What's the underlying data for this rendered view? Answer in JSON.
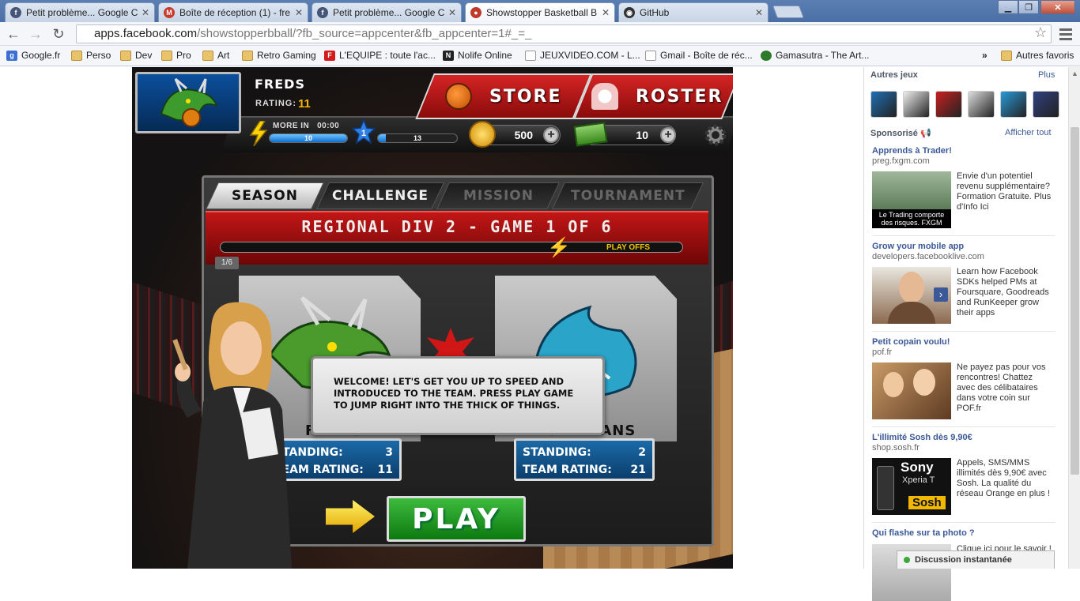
{
  "browser": {
    "tabs": [
      {
        "title": "Petit problème... Google C",
        "favicon_color": "#445577",
        "active": false
      },
      {
        "title": "Boîte de réception (1) - fre",
        "favicon_color": "#c73b2c",
        "active": false
      },
      {
        "title": "Petit problème... Google C",
        "favicon_color": "#445577",
        "active": false
      },
      {
        "title": "Showstopper Basketball B",
        "favicon_color": "#c0392b",
        "active": true
      },
      {
        "title": "GitHub",
        "favicon_color": "#333333",
        "active": false
      }
    ],
    "url_host": "apps.facebook.com",
    "url_path": "/showstopperbball/?fb_source=appcenter&fb_appcenter=1#_=_",
    "bookmarks": [
      {
        "label": "Google.fr",
        "icon": "google-icon"
      },
      {
        "label": "Perso",
        "icon": "folder-icon"
      },
      {
        "label": "Dev",
        "icon": "folder-icon"
      },
      {
        "label": "Pro",
        "icon": "folder-icon"
      },
      {
        "label": "Art",
        "icon": "folder-icon"
      },
      {
        "label": "Retro Gaming",
        "icon": "folder-icon"
      },
      {
        "label": "L'EQUIPE : toute l'ac...",
        "icon": "lequipe-icon"
      },
      {
        "label": "Nolife Online",
        "icon": "nolife-icon"
      },
      {
        "label": "JEUXVIDEO.COM - L...",
        "icon": "page-icon"
      },
      {
        "label": "Gmail - Boîte de réc...",
        "icon": "page-icon"
      },
      {
        "label": "Gamasutra - The Art...",
        "icon": "gamasutra-icon"
      }
    ],
    "bookmarks_overflow": "»",
    "other_bookmarks": "Autres favoris"
  },
  "game": {
    "team_name": "FREDS",
    "rating_label": "RATING:",
    "rating_value": "11",
    "store_label": "STORE",
    "roster_label": "ROSTER",
    "more_in_label": "MORE IN",
    "more_in_time": "00:00",
    "energy_value": "10",
    "energy_fraction": 1.0,
    "level": "1",
    "xp_value": "13",
    "xp_fraction": 0.1,
    "coins": "500",
    "cash": "10",
    "tabs": [
      "SEASON",
      "CHALLENGE",
      "MISSION",
      "TOURNAMENT"
    ],
    "game_title": "REGIONAL DIV 2 - GAME 1 OF 6",
    "playoffs_label": "PLAY OFFS",
    "step_badge": "1/6",
    "progress_fraction": 0.0,
    "home_team": {
      "name": "FREDS",
      "standing_label": "STANDING:",
      "standing": "3",
      "rating_label": "TEAM RATING:",
      "rating": "11"
    },
    "away_team": {
      "name": "SPARTANS",
      "standing_label": "STANDING:",
      "standing": "2",
      "rating_label": "TEAM RATING:",
      "rating": "21"
    },
    "welcome_text": "WELCOME! LET'S GET YOU UP TO SPEED AND INTRODUCED TO THE TEAM. PRESS PLAY GAME TO JUMP RIGHT INTO THE THICK OF THINGS.",
    "play_label": "PLAY"
  },
  "sidebar": {
    "other_games_label": "Autres jeux",
    "more_label": "Plus",
    "game_icons": [
      "#1e6fb5",
      "#eeeeee",
      "#c82020",
      "#dddddd",
      "#2a9ad8",
      "#304080"
    ],
    "sponsored_label": "Sponsorisé",
    "show_all_label": "Afficher tout",
    "ads": [
      {
        "title": "Apprends à Trader!",
        "domain": "preg.fxgm.com",
        "body": "Envie d'un potentiel revenu supplémentaire? Formation Gratuite. Plus d'Info Ici",
        "image_caption": "Le Trading comporte des risques. FXGM"
      },
      {
        "title": "Grow your mobile app",
        "domain": "developers.facebooklive.com",
        "body": "Learn how Facebook SDKs helped PMs at Foursquare, Goodreads and RunKeeper grow their apps",
        "image_caption": ""
      },
      {
        "title": "Petit copain voulu!",
        "domain": "pof.fr",
        "body": "Ne payez pas pour vos rencontres! Chattez avec des célibataires dans votre coin sur POF.fr",
        "image_caption": ""
      },
      {
        "title": "L'illimité Sosh dès 9,90€",
        "domain": "shop.sosh.fr",
        "body": "Appels, SMS/MMS illimités dès 9,90€ avec Sosh. La qualité du réseau Orange en plus !",
        "image_caption": ""
      },
      {
        "title": "Qui flashe sur ta photo ?",
        "domain": "",
        "body": "Clique ici pour le savoir !",
        "image_caption": ""
      }
    ],
    "sosh_brand": "Sony",
    "sosh_model": "Xperia T",
    "sosh_logo": "Sosh",
    "chat_label": "Discussion instantanée"
  }
}
